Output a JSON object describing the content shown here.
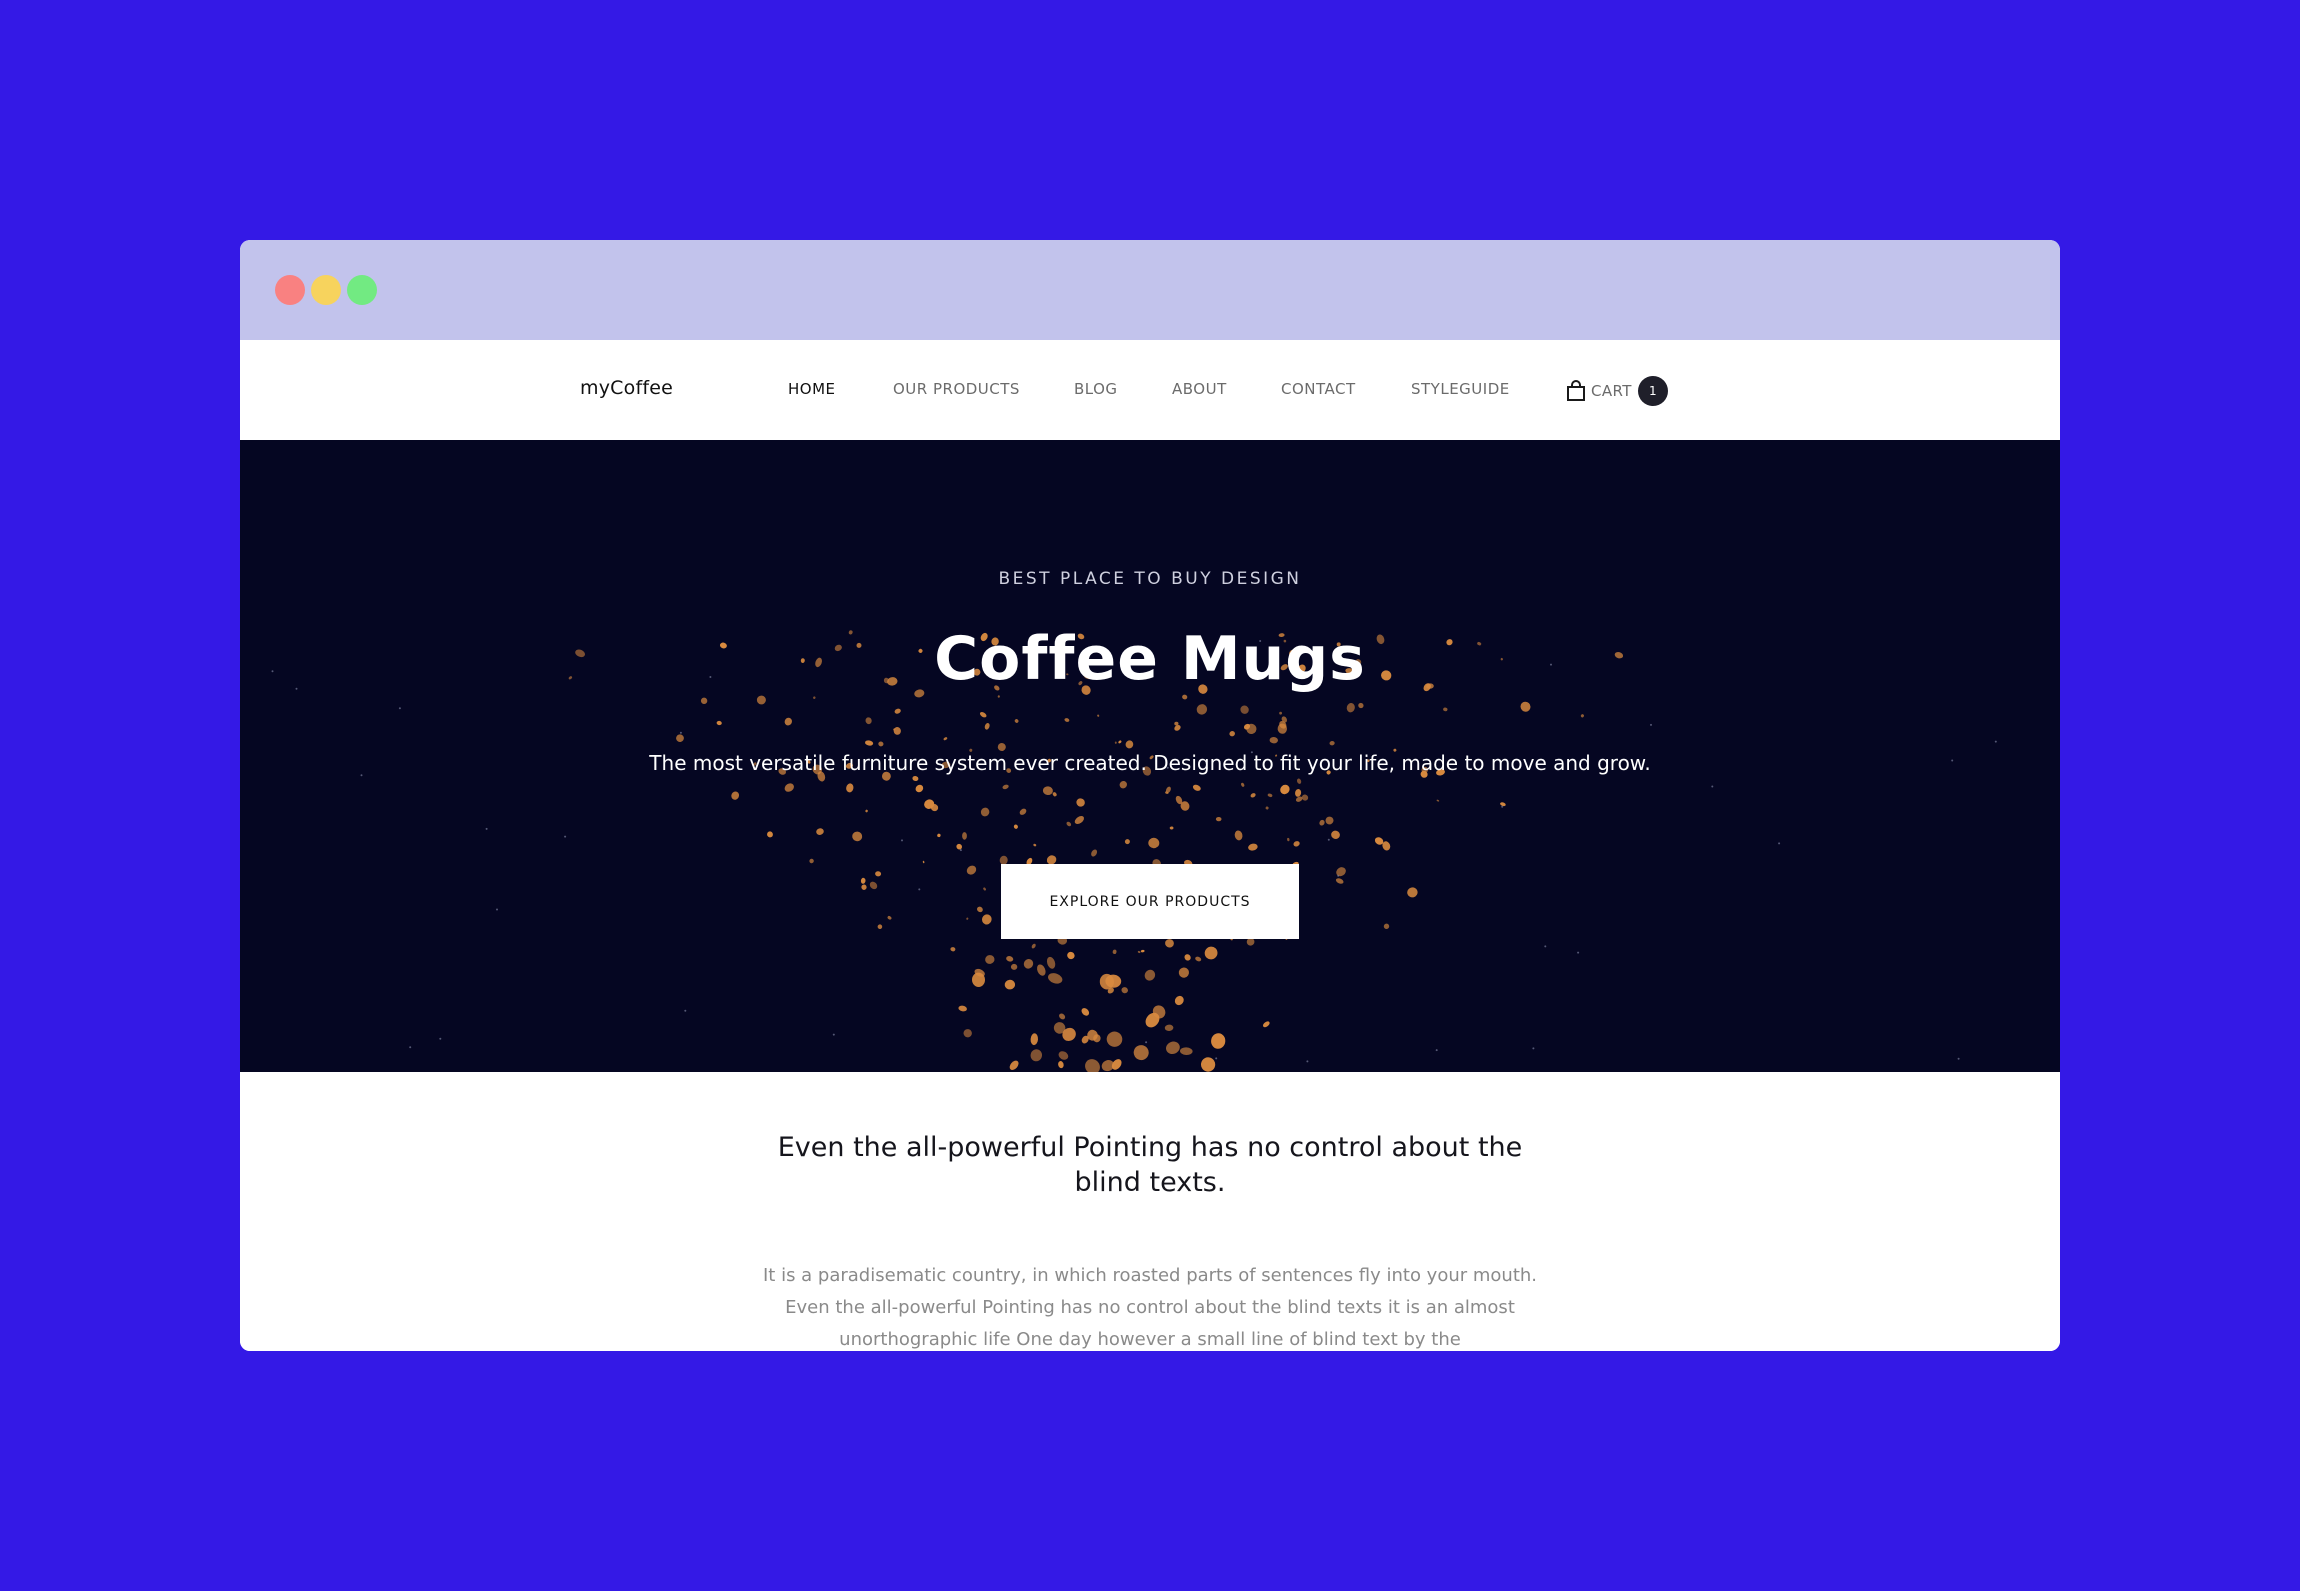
{
  "window": {
    "controls": [
      "close",
      "minimize",
      "maximize"
    ],
    "colors": {
      "close": "#f98181",
      "minimize": "#f7d35d",
      "maximize": "#72ea82"
    }
  },
  "nav": {
    "brand": "myCoffee",
    "links": [
      {
        "label": "HOME",
        "active": true
      },
      {
        "label": "OUR PRODUCTS",
        "active": false
      },
      {
        "label": "BLOG",
        "active": false
      },
      {
        "label": "ABOUT",
        "active": false
      },
      {
        "label": "CONTACT",
        "active": false
      },
      {
        "label": "STYLEGUIDE",
        "active": false
      }
    ],
    "cart": {
      "icon": "shopping-bag-icon",
      "label": "CART",
      "count": "1"
    }
  },
  "hero": {
    "eyebrow": "BEST PLACE TO BUY DESIGN",
    "title": "Coffee Mugs",
    "subtitle": "The most versatile furniture system ever created. Designed to fit your life, made to move and grow.",
    "button": "EXPLORE OUR PRODUCTS",
    "background_color": "#050622",
    "particle_color": "#d98a3f"
  },
  "content": {
    "heading": "Even the all-powerful Pointing has no control about the blind texts.",
    "body": "It is a paradisematic country, in which roasted parts of sentences fly into your mouth. Even the all-powerful Pointing has no control about the blind texts it is an almost unorthographic life One day however a small line of blind text by the"
  },
  "colors": {
    "page_background": "#3419e6",
    "titlebar": "#c2c3ec"
  }
}
